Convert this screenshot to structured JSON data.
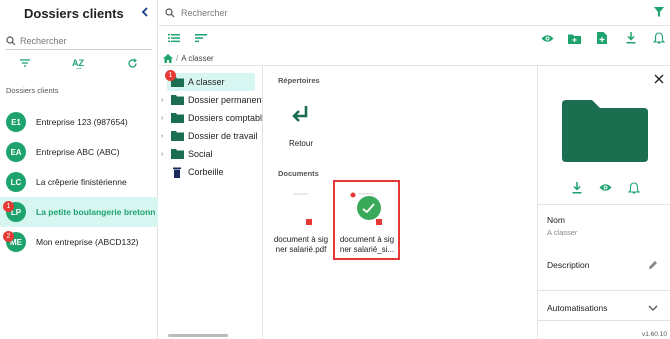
{
  "sidebar": {
    "title": "Dossiers clients",
    "search_placeholder": "Rechercher",
    "section_label": "Dossiers clients",
    "clients": [
      {
        "initials": "E1",
        "name": "Entreprise 123 (987654)",
        "badge": ""
      },
      {
        "initials": "EA",
        "name": "Entreprise ABC (ABC)",
        "badge": ""
      },
      {
        "initials": "LC",
        "name": "La crêperie finistérienne",
        "badge": ""
      },
      {
        "initials": "LP",
        "name": "La petite boulangerie bretonn",
        "badge": "1",
        "active": true
      },
      {
        "initials": "ME",
        "name": "Mon entreprise (ABCD132)",
        "badge": "2"
      }
    ]
  },
  "topbar": {
    "search_placeholder": "Rechercher"
  },
  "breadcrumb": {
    "current": "A classer"
  },
  "tree": {
    "items": [
      {
        "label": "A classer",
        "badge": "1",
        "active": true
      },
      {
        "label": "Dossier permanent"
      },
      {
        "label": "Dossiers comptables"
      },
      {
        "label": "Dossier de travail"
      },
      {
        "label": "Social"
      },
      {
        "label": "Corbeille"
      }
    ]
  },
  "content": {
    "folders_title": "Répertoires",
    "back_label": "Retour",
    "documents_title": "Documents",
    "documents": [
      {
        "name_line1": "document à sig",
        "name_line2": "ner salarié.pdf"
      },
      {
        "name_line1": "document à sig",
        "name_line2": "ner salarié_si..."
      }
    ]
  },
  "details": {
    "name_label": "Nom",
    "name_value": "A classer",
    "description_label": "Description",
    "automations_label": "Automatisations"
  },
  "version": "v1.60.10",
  "colors": {
    "accent": "#1ea36f",
    "badge": "#e53935",
    "highlight": "#d8f6f1"
  }
}
